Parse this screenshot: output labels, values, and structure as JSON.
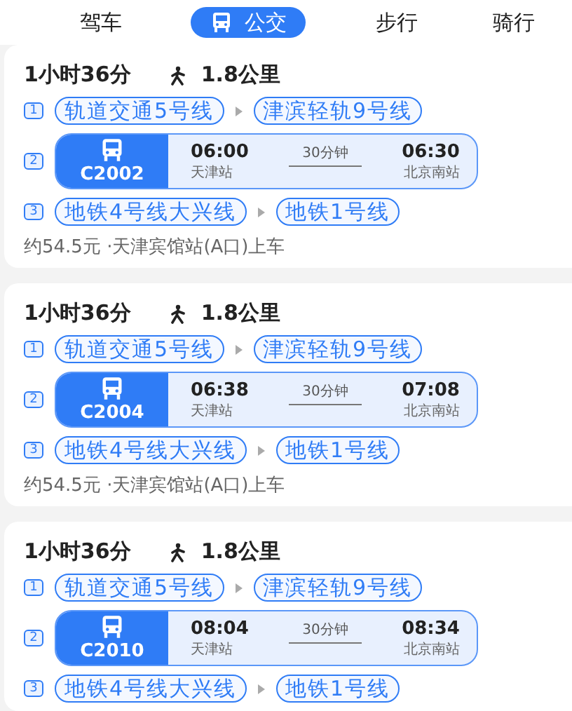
{
  "tabs": [
    {
      "label": "驾车",
      "selected": false
    },
    {
      "label": "公交",
      "selected": true
    },
    {
      "label": "步行",
      "selected": false
    },
    {
      "label": "骑行",
      "selected": false
    }
  ],
  "routes": [
    {
      "duration": "1小时36分",
      "walk": "1.8公里",
      "steps": [
        {
          "number": "1",
          "kind": "lines",
          "lines": [
            "轨道交通5号线",
            "津滨轻轨9号线"
          ]
        },
        {
          "number": "2",
          "kind": "train",
          "train": "C2002",
          "depart_time": "06:00",
          "depart_station": "天津站",
          "ride": "30分钟",
          "arrive_time": "06:30",
          "arrive_station": "北京南站"
        },
        {
          "number": "3",
          "kind": "lines",
          "lines": [
            "地铁4号线大兴线",
            "地铁1号线"
          ]
        }
      ],
      "fare": "约54.5元 ·天津宾馆站(A口)上车"
    },
    {
      "duration": "1小时36分",
      "walk": "1.8公里",
      "steps": [
        {
          "number": "1",
          "kind": "lines",
          "lines": [
            "轨道交通5号线",
            "津滨轻轨9号线"
          ]
        },
        {
          "number": "2",
          "kind": "train",
          "train": "C2004",
          "depart_time": "06:38",
          "depart_station": "天津站",
          "ride": "30分钟",
          "arrive_time": "07:08",
          "arrive_station": "北京南站"
        },
        {
          "number": "3",
          "kind": "lines",
          "lines": [
            "地铁4号线大兴线",
            "地铁1号线"
          ]
        }
      ],
      "fare": "约54.5元 ·天津宾馆站(A口)上车"
    },
    {
      "duration": "1小时36分",
      "walk": "1.8公里",
      "steps": [
        {
          "number": "1",
          "kind": "lines",
          "lines": [
            "轨道交通5号线",
            "津滨轻轨9号线"
          ]
        },
        {
          "number": "2",
          "kind": "train",
          "train": "C2010",
          "depart_time": "08:04",
          "depart_station": "天津站",
          "ride": "30分钟",
          "arrive_time": "08:34",
          "arrive_station": "北京南站"
        },
        {
          "number": "3",
          "kind": "lines",
          "lines": [
            "地铁4号线大兴线",
            "地铁1号线"
          ]
        }
      ]
    }
  ]
}
